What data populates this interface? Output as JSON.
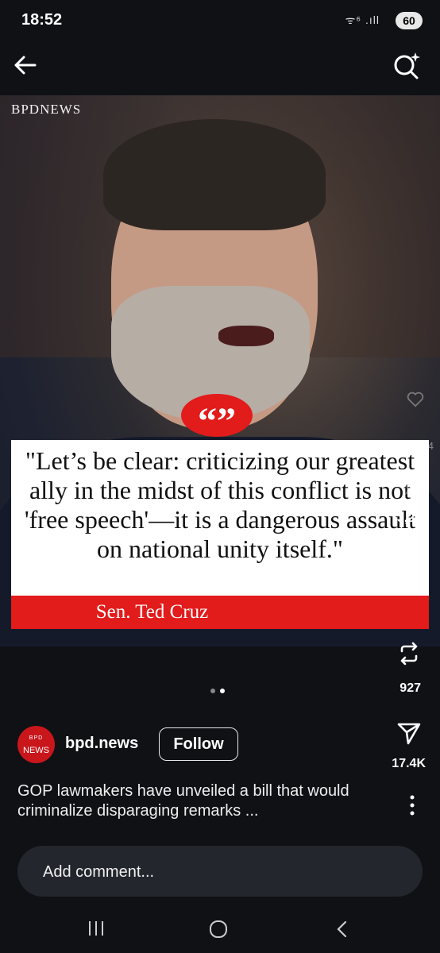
{
  "status_bar": {
    "time": "18:52",
    "signal": "ᯤ⁶ .ıll",
    "battery": "60"
  },
  "media": {
    "brand_mark": "BPDNEWS",
    "quote_mark": "“”",
    "quote": "\"Let’s be clear: criticizing our greatest ally in the midst of this conflict is not 'free speech'—it is a dangerous assault on national unity itself.\"",
    "attribution": "Sen. Ted Cruz",
    "carousel": {
      "count": 2,
      "active_index": 1
    }
  },
  "actions": {
    "likes": "6,484",
    "comments": "3,249",
    "reposts": "927",
    "shares": "17.4K"
  },
  "post": {
    "avatar_line1": "BPD",
    "avatar_line2": "NEWS",
    "handle": "bpd.news",
    "follow_label": "Follow",
    "caption": "GOP lawmakers have unveiled a bill that would criminalize disparaging remarks ..."
  },
  "comment_bar": {
    "placeholder": "Add comment..."
  },
  "nav_bar": {
    "items": [
      "recent-apps",
      "home",
      "back"
    ]
  },
  "colors": {
    "accent_red": "#e21b1b",
    "background": "#0f1115",
    "comment_bar": "#23262c"
  }
}
